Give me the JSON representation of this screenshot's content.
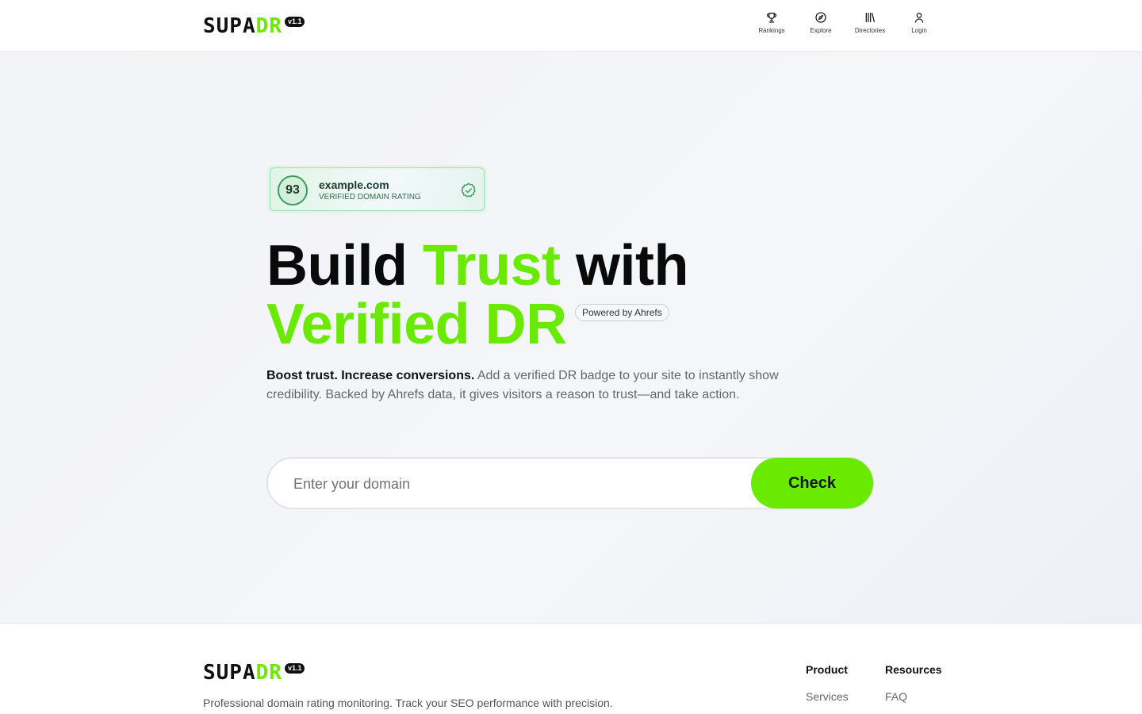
{
  "brand": {
    "name_part1": "SUPA",
    "name_part2": "DR",
    "version": "v1.1",
    "accent_color": "#6aea00"
  },
  "nav": {
    "items": [
      {
        "label": "Rankings",
        "icon": "trophy-icon"
      },
      {
        "label": "Explore",
        "icon": "compass-icon"
      },
      {
        "label": "Directories",
        "icon": "library-icon"
      },
      {
        "label": "Login",
        "icon": "user-icon"
      }
    ]
  },
  "badge": {
    "score": "93",
    "domain": "example.com",
    "caption": "VERIFIED DOMAIN RATING",
    "icon": "verified-check-icon"
  },
  "hero": {
    "title_word1": "Build",
    "title_word2": "Trust",
    "title_word3": "with",
    "title_line2": "Verified DR",
    "powered_label": "Powered by Ahrefs",
    "subtitle_bold": "Boost trust. Increase conversions.",
    "subtitle_rest": " Add a verified DR badge to your site to instantly show credibility. Backed by Ahrefs data, it gives visitors a reason to trust—and take action."
  },
  "search": {
    "placeholder": "Enter your domain",
    "value": "",
    "button_label": "Check"
  },
  "footer": {
    "tagline": "Professional domain rating monitoring. Track your SEO performance with precision.",
    "columns": [
      {
        "heading": "Product",
        "links": [
          "Services"
        ]
      },
      {
        "heading": "Resources",
        "links": [
          "FAQ"
        ]
      }
    ]
  }
}
